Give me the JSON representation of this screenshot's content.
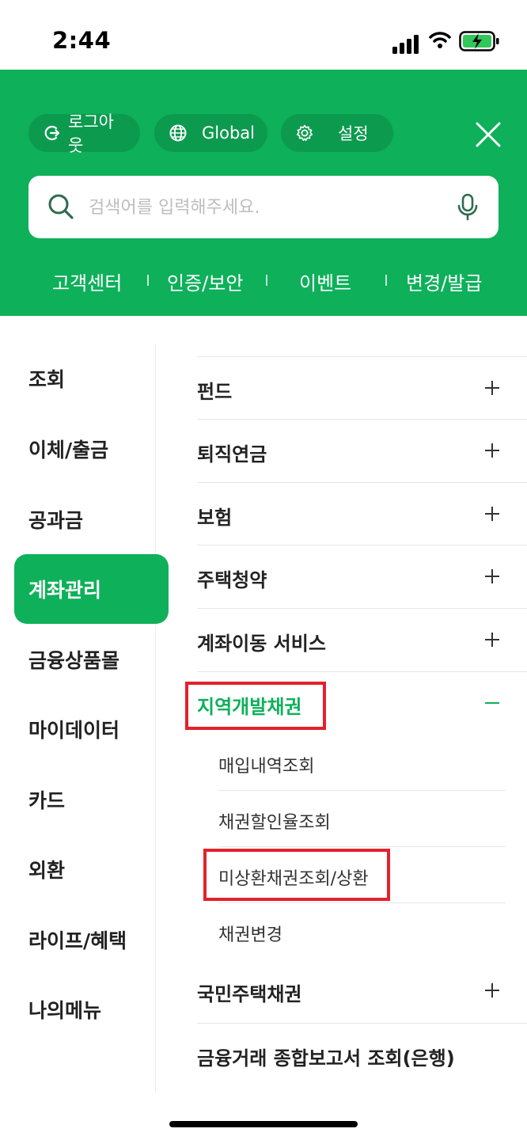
{
  "status_bar": {
    "time": "2:44"
  },
  "header": {
    "logout_label": "로그아웃",
    "global_label": "Global",
    "settings_label": "설정",
    "search_placeholder": "검색어를 입력해주세요.",
    "quick_links": [
      "고객센터",
      "인증/보안",
      "이벤트",
      "변경/발급"
    ]
  },
  "left_nav": {
    "items": [
      "조회",
      "이체/출금",
      "공과금",
      "계좌관리",
      "금융상품몰",
      "마이데이터",
      "카드",
      "외환",
      "라이프/혜택",
      "나의메뉴"
    ],
    "active": "계좌관리"
  },
  "menu": {
    "items": [
      {
        "label": "펀드",
        "control": "plus"
      },
      {
        "label": "퇴직연금",
        "control": "plus"
      },
      {
        "label": "보험",
        "control": "plus"
      },
      {
        "label": "주택청약",
        "control": "plus"
      },
      {
        "label": "계좌이동 서비스",
        "control": "plus"
      },
      {
        "label": "지역개발채권",
        "control": "minus",
        "expanded": true
      },
      {
        "label": "국민주택채권",
        "control": "plus"
      },
      {
        "label": "금융거래 종합보고서 조회(은행)",
        "control": "none"
      }
    ],
    "submenu": [
      "매입내역조회",
      "채권할인율조회",
      "미상환채권조회/상환",
      "채권변경"
    ]
  },
  "colors": {
    "brand_green": "#0eb05a",
    "highlight_red": "#e2222d"
  }
}
